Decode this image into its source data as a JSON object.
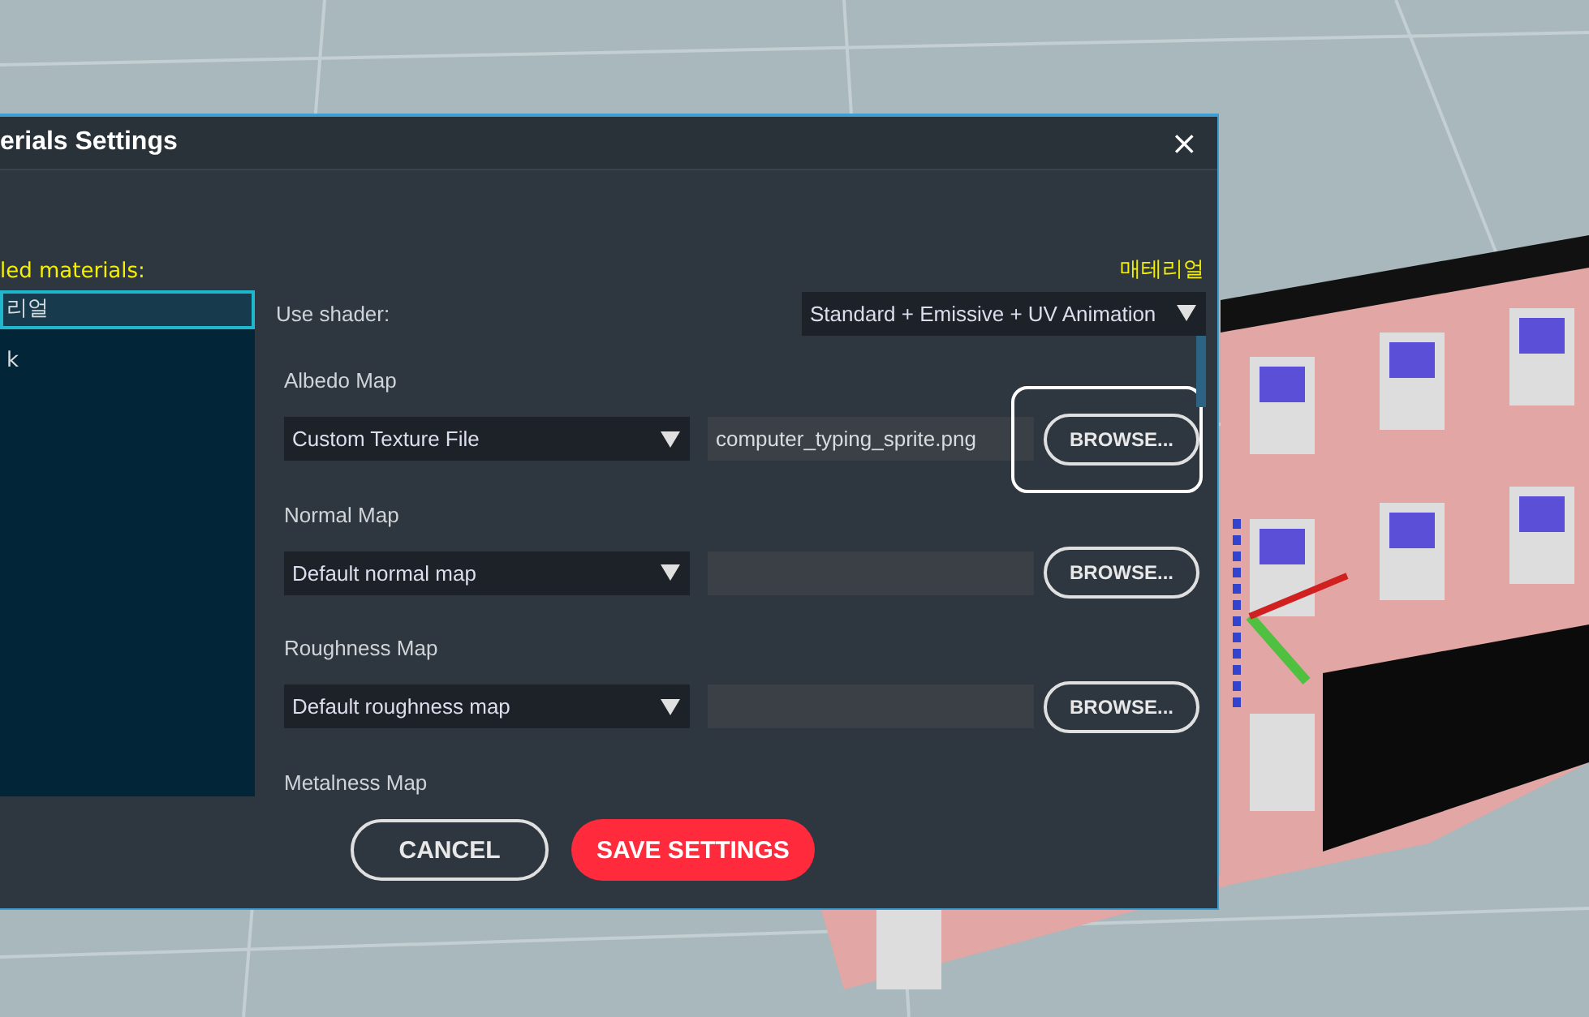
{
  "window": {
    "title": "erials Settings",
    "close": "×"
  },
  "materials": {
    "heading": "led materials:",
    "current": "매테리얼",
    "items": [
      {
        "label": "리얼",
        "selected": true
      },
      {
        "label": "k",
        "selected": false
      }
    ]
  },
  "shader": {
    "label": "Use shader:",
    "value": "Standard + Emissive + UV Animation"
  },
  "maps": [
    {
      "label": "Albedo Map",
      "source": "Custom Texture File",
      "file": "computer_typing_sprite.png",
      "button": "BROWSE...",
      "focused": true
    },
    {
      "label": "Normal Map",
      "source": "Default normal map",
      "button": "BROWSE...",
      "focused": false
    },
    {
      "label": "Roughness Map",
      "source": "Default roughness map",
      "button": "BROWSE...",
      "focused": false
    },
    {
      "label": "Metalness Map"
    }
  ],
  "buttons": [
    {
      "label": "CANCEL",
      "kind": "secondary"
    },
    {
      "label": "SAVE SETTINGS",
      "kind": "primary"
    }
  ]
}
